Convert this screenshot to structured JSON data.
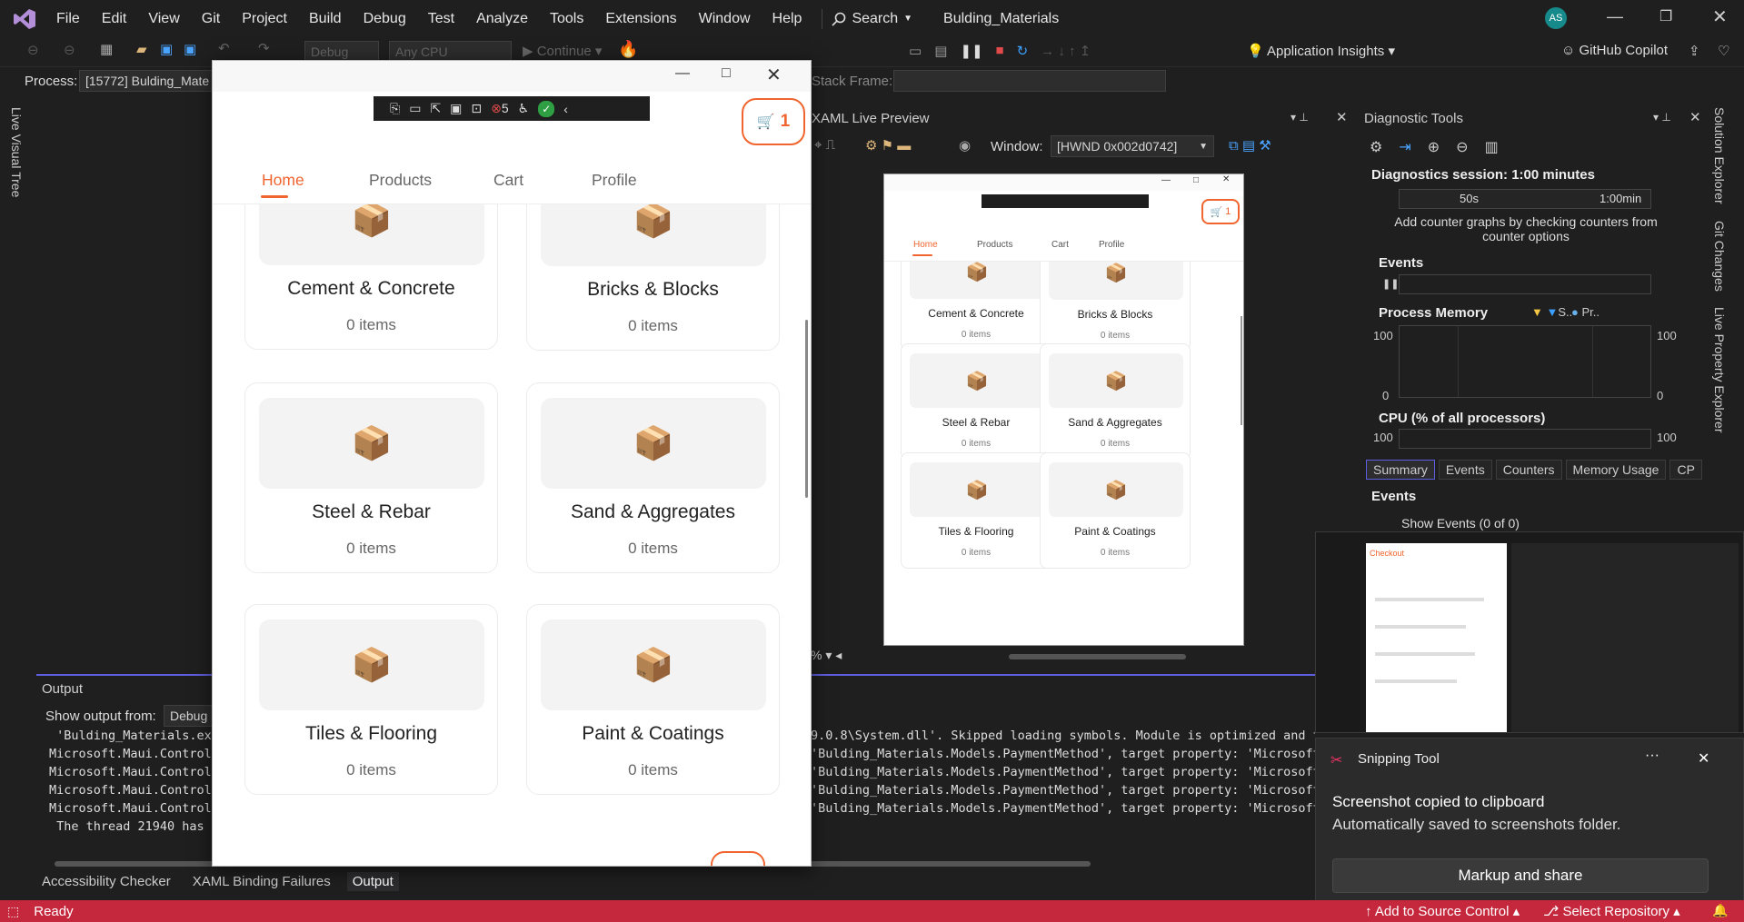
{
  "vs": {
    "menu": [
      "File",
      "Edit",
      "View",
      "Git",
      "Project",
      "Build",
      "Debug",
      "Test",
      "Analyze",
      "Tools",
      "Extensions",
      "Window",
      "Help"
    ],
    "search_label": "Search",
    "solution_name": "Bulding_Materials",
    "avatar_initials": "AS",
    "toolbar": {
      "config": "Debug",
      "platform": "Any CPU",
      "continue": "Continue",
      "app_insights": "Application Insights",
      "copilot": "GitHub Copilot"
    },
    "process_label": "Process:",
    "process_value": "[15772] Bulding_Mate",
    "stack_frame_label": "Stack Frame:",
    "live_visual_tree": "Live Visual Tree",
    "right_tabs": [
      "Solution Explorer",
      "Git Changes",
      "Live Property Explorer"
    ]
  },
  "xaml_preview": {
    "title": "XAML Live Preview",
    "window_label": "Window:",
    "window_value": "[HWND 0x002d0742]",
    "zoom": "%"
  },
  "diagnostics": {
    "title": "Diagnostic Tools",
    "session": "Diagnostics session: 1:00 minutes",
    "timeline": [
      "50s",
      "1:00min"
    ],
    "hint": "Add counter graphs by checking counters from counter options",
    "events": "Events",
    "process_memory": "Process Memory",
    "legend_s": "S..",
    "legend_pr": "Pr..",
    "mem_max": "100",
    "mem_min": "0",
    "cpu": "CPU (% of all processors)",
    "cpu_max": "100",
    "tabs": [
      "Summary",
      "Events",
      "Counters",
      "Memory Usage",
      "CP"
    ],
    "events_header": "Events",
    "show_events": "Show Events (0 of 0)"
  },
  "output": {
    "title": "Output",
    "show_from_label": "Show output from:",
    "show_from_value": "Debug",
    "lines_left": [
      " 'Bulding_Materials.exe",
      "Microsoft.Maui.Control",
      "Microsoft.Maui.Control",
      "Microsoft.Maui.Control",
      "Microsoft.Maui.Control",
      " The thread 21940 has e"
    ],
    "lines_right": [
      "9.0.8\\System.dll'. Skipped loading symbols. Module is optimized and t",
      "'Bulding_Materials.Models.PaymentMethod', target property: 'Microsoft",
      "'Bulding_Materials.Models.PaymentMethod', target property: 'Microsoft",
      "'Bulding_Materials.Models.PaymentMethod', target property: 'Microsoft",
      "'Bulding_Materials.Models.PaymentMethod', target property: 'Microsoft"
    ],
    "bottom_tabs": [
      "Accessibility Checker",
      "XAML Binding Failures",
      "Output"
    ]
  },
  "app": {
    "cart_count": "1",
    "debug_badge_count": "5",
    "nav": [
      "Home",
      "Products",
      "Cart",
      "Profile"
    ],
    "active_nav": "Home",
    "categories": [
      {
        "name": "Cement & Concrete",
        "count": "0 items"
      },
      {
        "name": "Bricks & Blocks",
        "count": "0 items"
      },
      {
        "name": "Steel & Rebar",
        "count": "0 items"
      },
      {
        "name": "Sand & Aggregates",
        "count": "0 items"
      },
      {
        "name": "Tiles & Flooring",
        "count": "0 items"
      },
      {
        "name": "Paint & Coatings",
        "count": "0 items"
      }
    ]
  },
  "toast": {
    "app": "Snipping Tool",
    "title": "Screenshot copied to clipboard",
    "body": "Automatically saved to screenshots folder.",
    "button": "Markup and share",
    "thumb_title": "Checkout"
  },
  "status": {
    "ready": "Ready",
    "source_control": "Add to Source Control",
    "repo": "Select Repository"
  },
  "colors": {
    "accent": "#f0652f",
    "status_bar": "#c5283d",
    "vs_bg": "#1f1f1f"
  }
}
